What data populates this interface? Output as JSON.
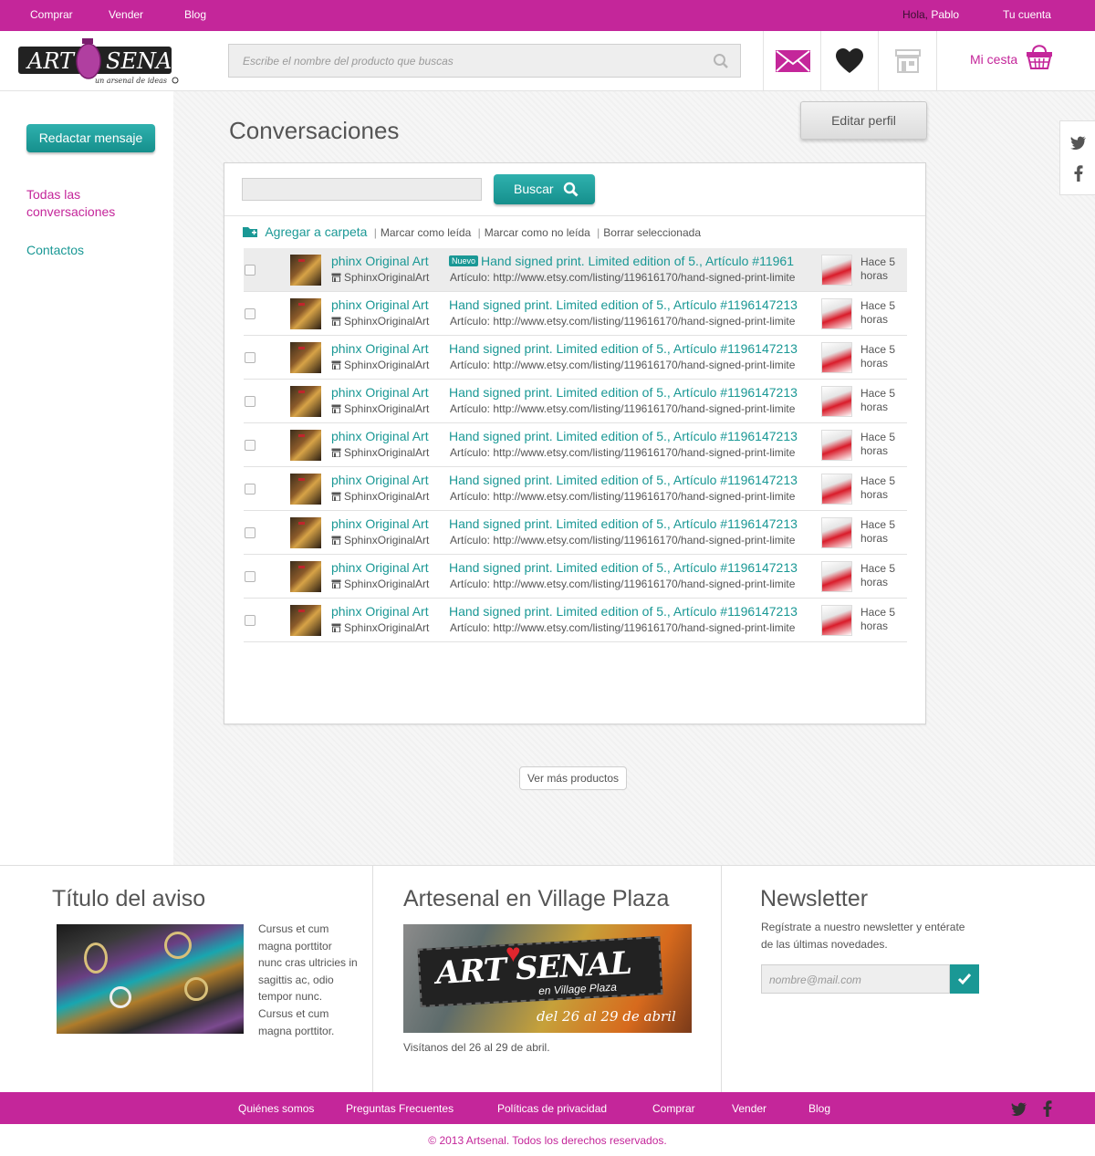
{
  "topbar": {
    "links": [
      "Comprar",
      "Vender",
      "Blog"
    ],
    "greeting_prefix": "Hola,",
    "user_name": "Pablo",
    "account_label": "Tu cuenta"
  },
  "header": {
    "logo_text": "ART SENAL",
    "logo_tagline": "un arsenal de ideas",
    "search_placeholder": "Escribe el nombre del producto que buscas",
    "cart_label": "Mi cesta"
  },
  "sidebar": {
    "compose_label": "Redactar mensaje",
    "links": [
      "Todas las conversaciones",
      "Contactos"
    ]
  },
  "main": {
    "title": "Conversaciones",
    "edit_profile_label": "Editar perfil",
    "search_button_label": "Buscar",
    "actions": [
      "Agregar a carpeta",
      "Marcar como leída",
      "Marcar como no leída",
      "Borrar seleccionada"
    ],
    "new_badge": "Nuevo",
    "conversations": [
      {
        "seller": "phinx Original Art",
        "shop": "SphinxOriginalArt",
        "subject": "Hand signed print. Limited edition of 5., Artículo #11961",
        "link": "Artículo: http://www.etsy.com/listing/119616170/hand-signed-print-limite",
        "time": "Hace 5 horas",
        "is_new": true
      },
      {
        "seller": "phinx Original Art",
        "shop": "SphinxOriginalArt",
        "subject": "Hand signed print. Limited edition of 5., Artículo #1196147213",
        "link": "Artículo: http://www.etsy.com/listing/119616170/hand-signed-print-limite",
        "time": "Hace 5 horas",
        "is_new": false
      },
      {
        "seller": "phinx Original Art",
        "shop": "SphinxOriginalArt",
        "subject": "Hand signed print. Limited edition of 5., Artículo #1196147213",
        "link": "Artículo: http://www.etsy.com/listing/119616170/hand-signed-print-limite",
        "time": "Hace 5 horas",
        "is_new": false
      },
      {
        "seller": "phinx Original Art",
        "shop": "SphinxOriginalArt",
        "subject": "Hand signed print. Limited edition of 5., Artículo #1196147213",
        "link": "Artículo: http://www.etsy.com/listing/119616170/hand-signed-print-limite",
        "time": "Hace 5 horas",
        "is_new": false
      },
      {
        "seller": "phinx Original Art",
        "shop": "SphinxOriginalArt",
        "subject": "Hand signed print. Limited edition of 5., Artículo #1196147213",
        "link": "Artículo: http://www.etsy.com/listing/119616170/hand-signed-print-limite",
        "time": "Hace 5 horas",
        "is_new": false
      },
      {
        "seller": "phinx Original Art",
        "shop": "SphinxOriginalArt",
        "subject": "Hand signed print. Limited edition of 5., Artículo #1196147213",
        "link": "Artículo: http://www.etsy.com/listing/119616170/hand-signed-print-limite",
        "time": "Hace 5 horas",
        "is_new": false
      },
      {
        "seller": "phinx Original Art",
        "shop": "SphinxOriginalArt",
        "subject": "Hand signed print. Limited edition of 5., Artículo #1196147213",
        "link": "Artículo: http://www.etsy.com/listing/119616170/hand-signed-print-limite",
        "time": "Hace 5 horas",
        "is_new": false
      },
      {
        "seller": "phinx Original Art",
        "shop": "SphinxOriginalArt",
        "subject": "Hand signed print. Limited edition of 5., Artículo #1196147213",
        "link": "Artículo: http://www.etsy.com/listing/119616170/hand-signed-print-limite",
        "time": "Hace 5 horas",
        "is_new": false
      },
      {
        "seller": "phinx Original Art",
        "shop": "SphinxOriginalArt",
        "subject": "Hand signed print. Limited edition of 5., Artículo #1196147213",
        "link": "Artículo: http://www.etsy.com/listing/119616170/hand-signed-print-limite",
        "time": "Hace 5 horas",
        "is_new": false
      }
    ],
    "more_label": "Ver más productos"
  },
  "footer": {
    "notice": {
      "title": "Título del aviso",
      "text": "Cursus et cum magna porttitor nunc cras ultricies in sagittis ac, odio tempor nunc. Cursus et cum magna porttitor."
    },
    "village": {
      "title": "Artesenal en Village Plaza",
      "banner_brand": "ART SENAL",
      "banner_sub": "en Village Plaza",
      "banner_dates": "del 26 al 29 de abril",
      "caption": "Visítanos del 26 al 29 de abril."
    },
    "newsletter": {
      "title": "Newsletter",
      "text": "Regístrate a nuestro newsletter y entérate de las últimas novedades.",
      "placeholder": "nombre@mail.com"
    },
    "links": [
      "Quiénes somos",
      "Preguntas Frecuentes",
      "Políticas de privacidad",
      "Comprar",
      "Vender",
      "Blog"
    ],
    "copyright": "© 2013 Artsenal. Todos los derechos reservados."
  },
  "colors": {
    "brand": "#c4269a",
    "accent": "#1a9895"
  },
  "icons": [
    "search-icon",
    "mail-icon",
    "heart-icon",
    "store-icon",
    "basket-icon",
    "twitter-icon",
    "facebook-icon",
    "folder-icon",
    "check-icon"
  ]
}
